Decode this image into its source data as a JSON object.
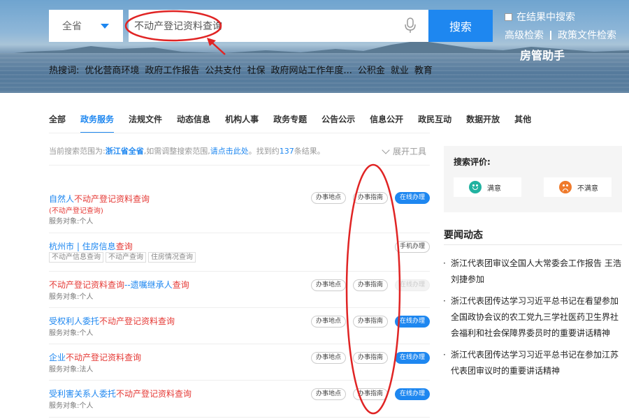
{
  "header": {
    "region_label": "全省",
    "search_value": "不动产登记资料查询",
    "search_button": "搜索",
    "within_results": "在结果中搜索",
    "advanced_search": "高级检索",
    "policy_search": "政策文件检索",
    "assistant": "房管助手",
    "hot_label": "热搜词:",
    "hot_words": [
      "优化营商环境",
      "政府工作报告",
      "公共支付",
      "社保",
      "政府网站工作年度...",
      "公积金",
      "就业",
      "教育"
    ]
  },
  "tabs": [
    "全部",
    "政务服务",
    "法规文件",
    "动态信息",
    "机构人事",
    "政务专题",
    "公告公示",
    "信息公开",
    "政民互动",
    "数据开放",
    "其他"
  ],
  "scope": {
    "prefix": "当前搜索范围为:",
    "region": "浙江省全省",
    "mid": ",如需调整搜索范围,",
    "link": "请点击此处",
    "found_prefix": "。找到约",
    "count": "137",
    "found_suffix": "条结果。",
    "expand_tools": "展开工具"
  },
  "results": [
    {
      "title_parts": [
        {
          "t": "自然人",
          "red": false
        },
        {
          "t": "不动产登记资料查询",
          "red": true
        }
      ],
      "alias": "(不动产登记查询)",
      "meta": "服务对象:个人",
      "buttons": [
        {
          "label": "办事地点",
          "style": "outline"
        },
        {
          "label": "办事指南",
          "style": "outline"
        },
        {
          "label": "在线办理",
          "style": "primary"
        }
      ]
    },
    {
      "title_parts": [
        {
          "t": "杭州市 | 住房信息",
          "red": false
        },
        {
          "t": "查询",
          "red": true
        }
      ],
      "tags": [
        "不动产信息查询",
        "不动产查询",
        "住房情况查询"
      ],
      "buttons": [
        {
          "label": "手机办理",
          "style": "outline"
        }
      ]
    },
    {
      "title_parts": [
        {
          "t": "不动产登记资料查询",
          "red": true
        },
        {
          "t": "--遗嘱继承人",
          "red": false
        },
        {
          "t": "查询",
          "red": true
        }
      ],
      "meta": "服务对象:个人",
      "buttons": [
        {
          "label": "办事地点",
          "style": "outline"
        },
        {
          "label": "办事指南",
          "style": "outline"
        },
        {
          "label": "在线办理",
          "style": "disabled"
        }
      ]
    },
    {
      "title_parts": [
        {
          "t": "受权利人委托",
          "red": false
        },
        {
          "t": "不动产登记资料查询",
          "red": true
        }
      ],
      "meta": "服务对象:个人",
      "buttons": [
        {
          "label": "办事地点",
          "style": "outline"
        },
        {
          "label": "办事指南",
          "style": "outline"
        },
        {
          "label": "在线办理",
          "style": "primary"
        }
      ]
    },
    {
      "title_parts": [
        {
          "t": "企业",
          "red": false
        },
        {
          "t": "不动产登记资料查询",
          "red": true
        }
      ],
      "meta": "服务对象:法人",
      "buttons": [
        {
          "label": "办事地点",
          "style": "outline"
        },
        {
          "label": "办事指南",
          "style": "outline"
        },
        {
          "label": "在线办理",
          "style": "primary"
        }
      ]
    },
    {
      "title_parts": [
        {
          "t": "受利害关系人委托",
          "red": false
        },
        {
          "t": "不动产登记资料查询",
          "red": true
        }
      ],
      "meta": "服务对象:个人",
      "buttons": [
        {
          "label": "办事地点",
          "style": "outline"
        },
        {
          "label": "办事指南",
          "style": "outline"
        },
        {
          "label": "在线办理",
          "style": "primary"
        }
      ]
    }
  ],
  "evaluation": {
    "title": "搜索评价:",
    "satisfied": "满意",
    "unsatisfied": "不满意"
  },
  "news": {
    "title": "要闻动态",
    "items": [
      "浙江代表团审议全国人大常委会工作报告 王浩刘捷参加",
      "浙江代表团传达学习习近平总书记在看望参加全国政协会议的农工党九三学社医药卫生界社会福利和社会保障界委员时的重要讲话精神",
      "浙江代表团传达学习习近平总书记在参加江苏代表团审议时的重要讲话精神"
    ]
  },
  "colors": {
    "accent": "#1e87f0",
    "highlight": "#e53935",
    "annotation": "#e02424"
  }
}
